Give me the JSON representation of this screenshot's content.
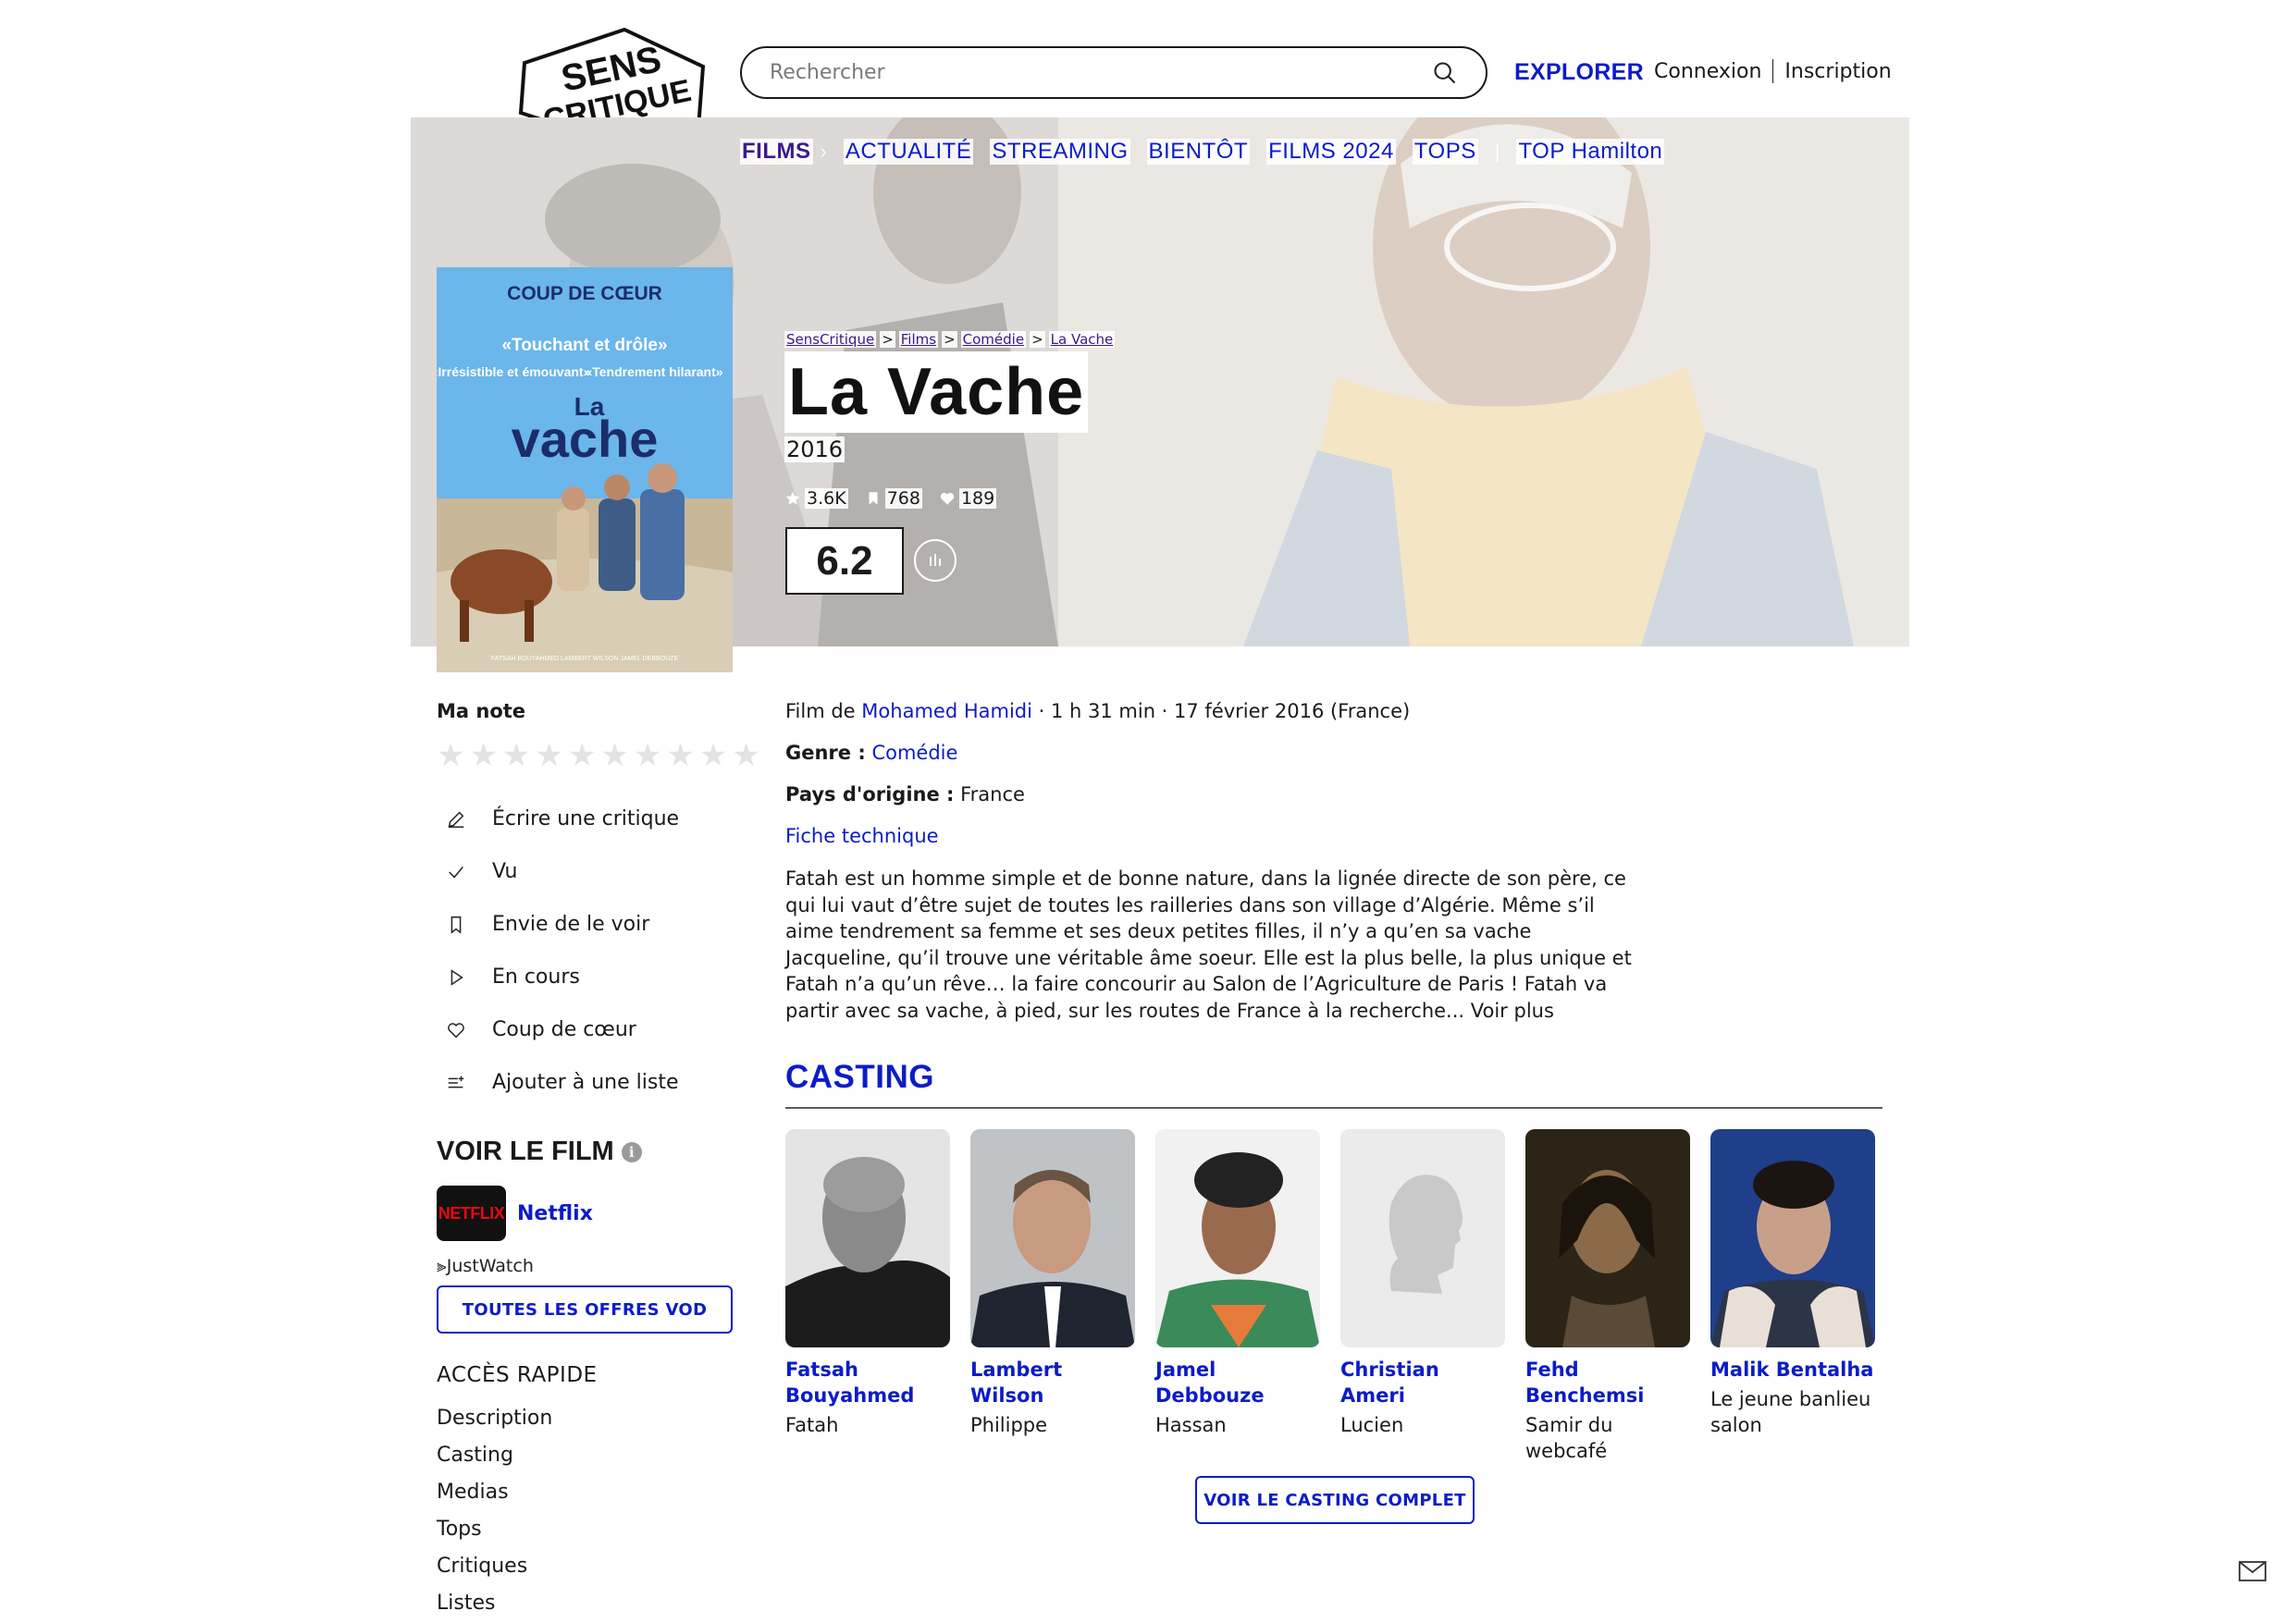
{
  "header": {
    "logo_text_line1": "SENS",
    "logo_text_line2": "CRITIQUE",
    "search_placeholder": "Rechercher",
    "explorer": "EXPLORER",
    "login": "Connexion",
    "signup": "Inscription"
  },
  "subnav": {
    "items": [
      "FILMS",
      "ACTUALITÉ",
      "STREAMING",
      "BIENTÔT",
      "FILMS 2024",
      "TOPS",
      "TOP Hamilton"
    ]
  },
  "breadcrumb": [
    "SensCritique",
    "Films",
    "Comédie",
    "La Vache"
  ],
  "movie": {
    "title": "La Vache",
    "year": "2016",
    "ratings_count": "3.6K",
    "wishlist_count": "768",
    "favorites_count": "189",
    "score": "6.2",
    "director_prefix": "Film de",
    "director": "Mohamed Hamidi",
    "meta_suffix": "· 1 h 31 min · 17 février 2016 (France)",
    "genre_label": "Genre :",
    "genre": "Comédie",
    "country_label": "Pays d'origine :",
    "country": "France",
    "tech_sheet": "Fiche technique",
    "synopsis": "Fatah est un homme simple et de bonne nature, dans la lignée directe de son père, ce qui lui vaut d’être sujet de toutes les railleries dans son village d’Algérie. Même s’il aime tendrement sa femme et ses deux petites filles, il n’y a qu’en sa vache Jacqueline, qu’il trouve une véritable âme soeur. Elle est la plus belle, la plus unique et Fatah n’a qu’un rêve… la faire concourir au Salon de l’Agriculture de Paris ! Fatah va partir avec sa vache, à pied, sur les routes de France à la recherche... Voir plus"
  },
  "poster": {
    "headline": "COUP DE CŒUR",
    "quote1": "«Touchant et drôle»",
    "quote2": "«Irrésistible et émouvant»",
    "quote3": "«Tendrement hilarant»",
    "title_small": "La",
    "title_big": "vache",
    "credits": "FATSAH BOUYAHMED   LAMBERT WILSON   JAMEL DEBBOUZE"
  },
  "sidebar": {
    "my_rating": "Ma note",
    "stars": 10,
    "actions": [
      {
        "label": "Écrire une critique",
        "icon": "pencil-icon"
      },
      {
        "label": "Vu",
        "icon": "check-icon"
      },
      {
        "label": "Envie de le voir",
        "icon": "bookmark-icon"
      },
      {
        "label": "En cours",
        "icon": "play-icon"
      },
      {
        "label": "Coup de cœur",
        "icon": "heart-icon"
      },
      {
        "label": "Ajouter à une liste",
        "icon": "list-add-icon"
      }
    ],
    "watch_title": "VOIR LE FILM",
    "provider_logo": "NETFLIX",
    "provider": "Netflix",
    "justwatch": "JustWatch",
    "vod_button": "TOUTES LES OFFRES VOD",
    "quick_title": "ACCÈS RAPIDE",
    "quick_links": [
      "Description",
      "Casting",
      "Medias",
      "Tops",
      "Critiques",
      "Listes"
    ]
  },
  "casting": {
    "title": "CASTING",
    "actors": [
      {
        "name": "Fatsah Bouyahmed",
        "role": "Fatah"
      },
      {
        "name": "Lambert Wilson",
        "role": "Philippe"
      },
      {
        "name": "Jamel Debbouze",
        "role": "Hassan"
      },
      {
        "name": "Christian Ameri",
        "role": "Lucien"
      },
      {
        "name": "Fehd Benchemsi",
        "role": "Samir du webcafé"
      },
      {
        "name": "Malik Bentalha",
        "role": "Le jeune banlieu salon"
      }
    ],
    "full_button": "VOIR LE CASTING COMPLET"
  },
  "colors": {
    "accent": "#0c1cc9",
    "purple": "#3a1a8a",
    "netflix_red": "#e50914"
  }
}
